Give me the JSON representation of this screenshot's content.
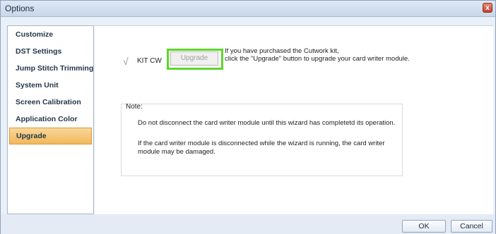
{
  "window": {
    "title": "Options",
    "close_glyph": "x"
  },
  "sidebar": {
    "items": [
      {
        "label": "Customize",
        "selected": false
      },
      {
        "label": "DST Settings",
        "selected": false
      },
      {
        "label": "Jump Stitch Trimming",
        "selected": false
      },
      {
        "label": "System Unit",
        "selected": false
      },
      {
        "label": "Screen Calibration",
        "selected": false
      },
      {
        "label": "Application Color",
        "selected": false
      },
      {
        "label": "Upgrade",
        "selected": true
      }
    ]
  },
  "main": {
    "check_glyph": "√",
    "kit_label": "KIT CW",
    "upgrade_button_label": "Upgrade",
    "info_line1": "If you have purchased the Cutwork kit,",
    "info_line2": "click the \"Upgrade\" button to upgrade your card writer module.",
    "note": {
      "label": "Note:",
      "line1": "Do not disconnect the card writer module until this wizard has completetd its operation.",
      "line2": "If the card writer module is disconnected while the wizard is running, the card writer module may be damaged."
    }
  },
  "footer": {
    "ok_label": "OK",
    "cancel_label": "Cancel"
  },
  "colors": {
    "highlight": "#5dd629",
    "selected_item": "#f1b85a"
  }
}
